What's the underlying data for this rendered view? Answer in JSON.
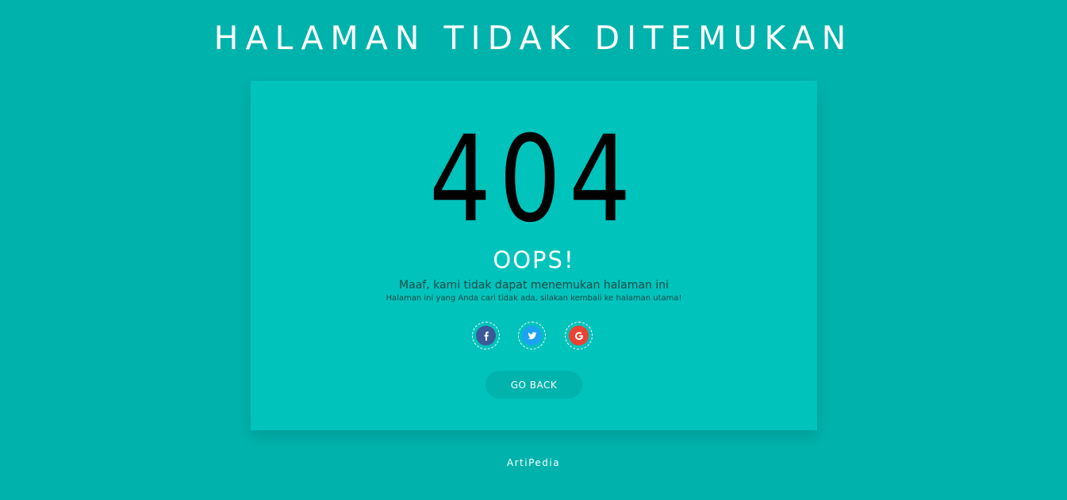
{
  "page": {
    "title": "HALAMAN TIDAK DITEMUKAN",
    "background_color": "#00b2ac"
  },
  "card": {
    "background_color": "#00c3bc",
    "error_code": "404",
    "heading": "OOPS!",
    "message": "Maaf, kami tidak dapat menemukan halaman ini",
    "sub_message": "Halaman ini yang Anda cari tidak ada, silakan kembali ke halaman utama!",
    "socials": [
      {
        "name": "facebook",
        "icon": "facebook-icon",
        "color": "#3b5998"
      },
      {
        "name": "twitter",
        "icon": "twitter-icon",
        "color": "#1da1f2"
      },
      {
        "name": "google",
        "icon": "google-icon",
        "color": "#ea4335"
      }
    ],
    "go_back_label": "GO BACK"
  },
  "footer": {
    "text": "ArtiPedia"
  }
}
